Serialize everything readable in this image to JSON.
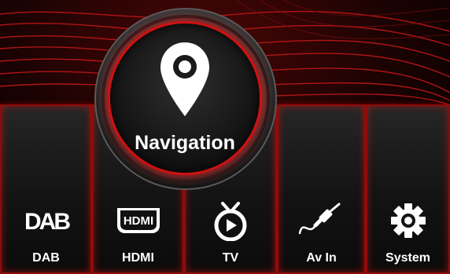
{
  "navigation": {
    "label": "Navigation"
  },
  "tiles": [
    {
      "id": "dab",
      "label": "DAB",
      "icon": "dab-logo-icon"
    },
    {
      "id": "hdmi",
      "label": "HDMI",
      "icon": "hdmi-logo-icon"
    },
    {
      "id": "tv",
      "label": "TV",
      "icon": "tv-icon"
    },
    {
      "id": "avin",
      "label": "Av In",
      "icon": "av-cable-icon"
    },
    {
      "id": "system",
      "label": "System",
      "icon": "gear-icon"
    }
  ],
  "icon_text": {
    "dab": "DAB",
    "hdmi": "HDMI"
  },
  "colors": {
    "accent": "#e01414",
    "tile": "#1a1a1a",
    "background": "#000000"
  }
}
